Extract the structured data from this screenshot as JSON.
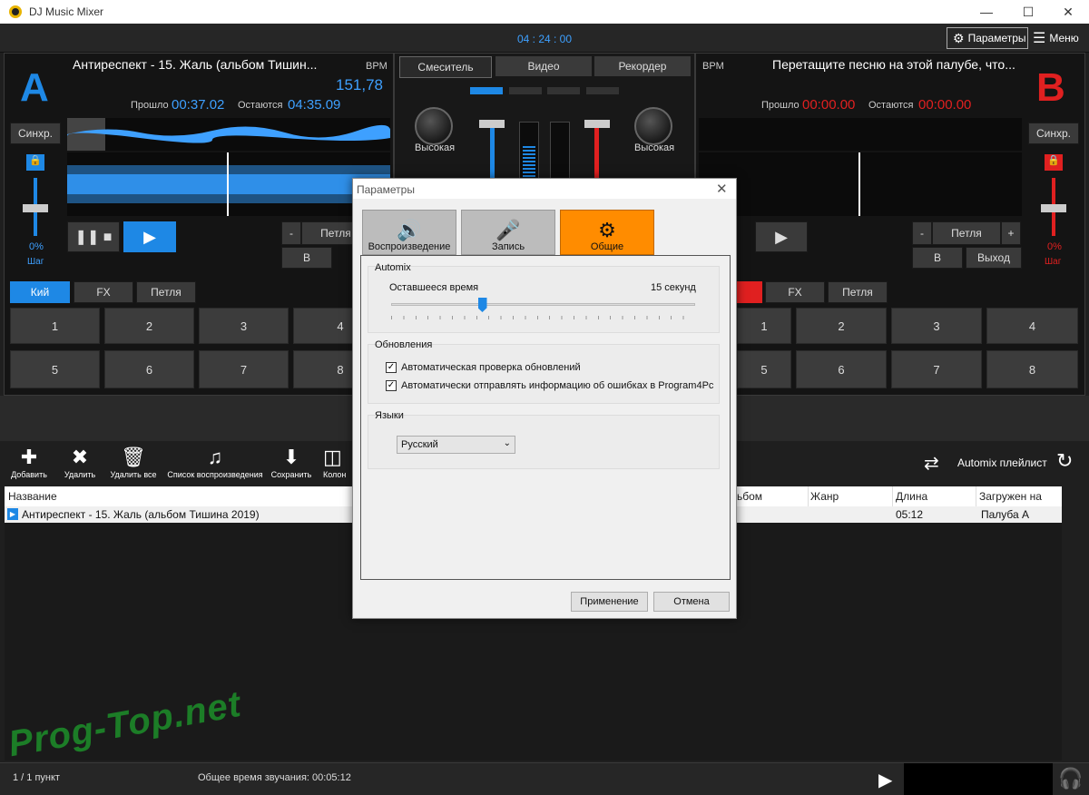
{
  "window": {
    "title": "DJ Music Mixer"
  },
  "topbar": {
    "clock": "04 : 24 : 00",
    "params_label": "Параметры",
    "menu_label": "Меню"
  },
  "deck_a": {
    "letter": "A",
    "track": "Антиреспект - 15. Жаль (альбом Тишин...",
    "bpm_label": "BPM",
    "bpm": "151,78",
    "elapsed_label": "Прошло",
    "elapsed": "00:37.02",
    "remaining_label": "Остаются",
    "remaining": "04:35.09",
    "sync_label": "Синхр.",
    "pitch": "0%",
    "step_label": "Шаг",
    "loop_label": "Петля",
    "minus": "-",
    "b_label": "В",
    "tabs": [
      "Кий",
      "FX",
      "Петля"
    ],
    "pads": [
      "1",
      "2",
      "3",
      "4",
      "5",
      "6",
      "7",
      "8"
    ]
  },
  "deck_b": {
    "letter": "B",
    "track": "Перетащите песню на этой палубе, что...",
    "bpm_label": "BPM",
    "elapsed_label": "Прошло",
    "elapsed": "00:00.00",
    "remaining_label": "Остаются",
    "remaining": "00:00.00",
    "sync_label": "Синхр.",
    "pitch": "0%",
    "step_label": "Шаг",
    "loop_label": "Петля",
    "minus": "-",
    "plus": "+",
    "b_label": "В",
    "exit_label": "Выход",
    "tabs": [
      "FX",
      "Петля"
    ],
    "pads": [
      "1",
      "2",
      "3",
      "4",
      "5",
      "6",
      "7",
      "8"
    ]
  },
  "mixer": {
    "tabs": [
      "Смеситель",
      "Видео",
      "Рекордер"
    ],
    "knob_high": "Высокая"
  },
  "toolbar": {
    "add": "Добавить",
    "remove": "Удалить",
    "remove_all": "Удалить все",
    "playlist": "Список воспроизведения",
    "save": "Сохранить",
    "columns": "Колон",
    "automix": "Automix плейлист"
  },
  "table": {
    "headers": {
      "name": "Название",
      "album": "ьбом",
      "genre": "Жанр",
      "length": "Длина",
      "loaded": "Загружен на"
    },
    "rows": [
      {
        "name": "Антиреспект - 15. Жаль (альбом Тишина 2019)",
        "length": "05:12",
        "loaded": "Палуба А"
      }
    ]
  },
  "status": {
    "count": "1 / 1 пункт",
    "total": "Общее время звучания: 00:05:12"
  },
  "watermark": "Prog-Top.net",
  "dialog": {
    "title": "Параметры",
    "tabs": [
      "Воспроизведение",
      "Запись",
      "Общие"
    ],
    "automix": {
      "group": "Automix",
      "label": "Оставшееся время",
      "value_label": "15 секунд",
      "slider_fraction": 0.3
    },
    "updates": {
      "group": "Обновления",
      "check1": "Автоматическая проверка обновлений",
      "check2": "Автоматически отправлять информацию об ошибках в Program4Pc"
    },
    "languages": {
      "group": "Языки",
      "selected": "Русский"
    },
    "apply": "Применение",
    "cancel": "Отмена"
  },
  "colors": {
    "accent": "#1e88e5",
    "deck_b": "#e02020",
    "active_tab": "#ff8c00"
  }
}
